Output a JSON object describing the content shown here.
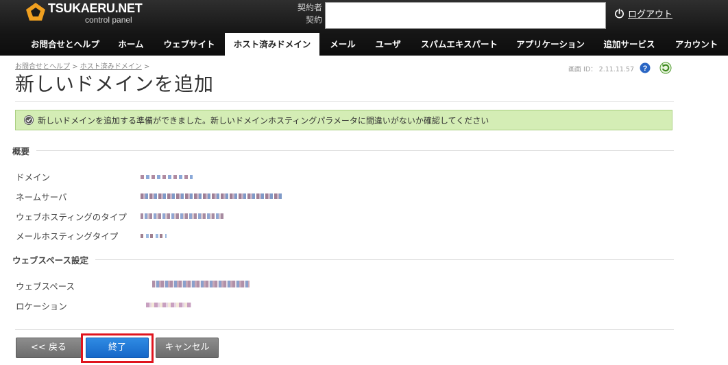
{
  "header": {
    "logo_name": "TSUKAERU.NET",
    "logo_sub": "control panel",
    "contract_label_1": "契約者",
    "contract_label_2": "契約",
    "logout_label": "ログアウト"
  },
  "nav": {
    "tabs": [
      {
        "label": "お問合せとヘルプ"
      },
      {
        "label": "ホーム"
      },
      {
        "label": "ウェブサイト"
      },
      {
        "label": "ホスト済みドメイン",
        "active": true
      },
      {
        "label": "メール"
      },
      {
        "label": "ユーザ"
      },
      {
        "label": "スパムエキスパート"
      },
      {
        "label": "アプリケーション"
      },
      {
        "label": "追加サービス"
      },
      {
        "label": "アカウント"
      }
    ]
  },
  "breadcrumb": {
    "items": [
      "お問合せとヘルプ",
      "ホスト済みドメイン"
    ],
    "separator": ">"
  },
  "screen_id": "画面 ID： 2.11.11.57",
  "page_title": "新しいドメインを追加",
  "message": {
    "text": "新しいドメインを追加する準備ができました。新しいドメインホスティングパラメータに間違いがないか確認してください"
  },
  "sections": {
    "overview": {
      "title": "概要",
      "rows": [
        {
          "label": "ドメイン"
        },
        {
          "label": "ネームサーバ"
        },
        {
          "label": "ウェブホスティングのタイプ"
        },
        {
          "label": "メールホスティングタイプ"
        }
      ]
    },
    "webspace": {
      "title": "ウェブスペース設定",
      "rows": [
        {
          "label": "ウェブスペース"
        },
        {
          "label": "ロケーション"
        }
      ]
    }
  },
  "buttons": {
    "back": "<< 戻る",
    "finish": "終了",
    "cancel": "キャンセル"
  },
  "colors": {
    "header_bg": "#151515",
    "logo_accent": "#f0a020",
    "message_bg": "#d4edb5",
    "message_border": "#a9cf80",
    "primary_button": "#1a6fd0",
    "highlight": "#e0141e"
  }
}
